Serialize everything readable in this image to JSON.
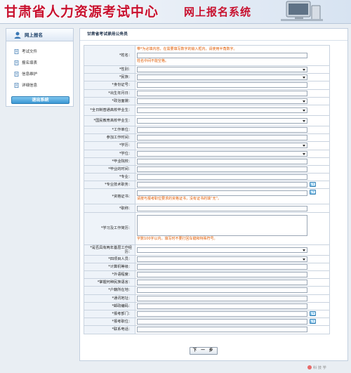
{
  "header": {
    "title": "甘肃省人力资源考试中心",
    "subtitle": "网上报名系统"
  },
  "sidebar": {
    "title": "网上报名",
    "items": [
      {
        "label": "考试文件"
      },
      {
        "label": "报名填表"
      },
      {
        "label": "信息维护"
      },
      {
        "label": "详细信息"
      }
    ],
    "logout_label": "退出系统"
  },
  "main": {
    "title": "甘肃省考试录用公务员",
    "name_hint_1": "带*为必填内容，在需要填写数字的输入框内，请使用半角数字。",
    "name_hint_2": "姓名中间不能空格。",
    "cert_hint": "请按与报考职位要求的资格证书，没有证书的填“无”。",
    "resume_hint": "字数100字以内，填写时不要打回车键和特殊符号。",
    "next_label": "下 一 步",
    "rows": [
      {
        "label": "*姓名：",
        "type": "name"
      },
      {
        "label": "*性别：",
        "type": "select"
      },
      {
        "label": "*民族：",
        "type": "select"
      },
      {
        "label": "*身份证号：",
        "type": "input"
      },
      {
        "label": "*出生年月日：",
        "type": "input"
      },
      {
        "label": "*政治面貌：",
        "type": "select"
      },
      {
        "label": "*全日制普通高校毕业生：",
        "type": "select",
        "tall": true
      },
      {
        "label": "*国民教育高校毕业生：",
        "type": "select",
        "tall": true
      },
      {
        "label": "*工作单位：",
        "type": "input"
      },
      {
        "label": "参加工作时间：",
        "type": "input"
      },
      {
        "label": "*学历：",
        "type": "select"
      },
      {
        "label": "*学位：",
        "type": "select"
      },
      {
        "label": "*毕业院校：",
        "type": "input"
      },
      {
        "label": "*毕业的时间：",
        "type": "input"
      },
      {
        "label": "*专业：",
        "type": "input"
      },
      {
        "label": "*专业技术职务：",
        "type": "input-pick"
      },
      {
        "label": "*资格证书：",
        "type": "cert"
      },
      {
        "label": "*职称：",
        "type": "input"
      },
      {
        "label": "*学习及工作简历：",
        "type": "resume"
      },
      {
        "label": "*是否具有两年基层工作经历：",
        "type": "select",
        "tall": true
      },
      {
        "label": "*四项目人员：",
        "type": "select"
      },
      {
        "label": "*计算机等级：",
        "type": "input"
      },
      {
        "label": "*外语程度：",
        "type": "input"
      },
      {
        "label": "*掌握何种民族语言：",
        "type": "input"
      },
      {
        "label": "*户籍所在地：",
        "type": "input"
      },
      {
        "label": "*通讯地址：",
        "type": "input"
      },
      {
        "label": "*邮政编码：",
        "type": "input"
      },
      {
        "label": "*报考部门：",
        "type": "input-pick"
      },
      {
        "label": "*报考职位：",
        "type": "input-pick"
      },
      {
        "label": "*联系电话：",
        "type": "input"
      }
    ]
  },
  "watermark": "科 技 学"
}
